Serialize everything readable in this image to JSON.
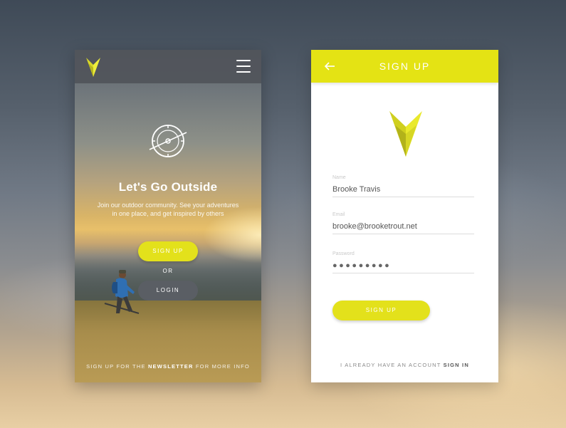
{
  "colors": {
    "accent": "#e3e11b",
    "login_button": "#5a5e64",
    "nav_overlay": "#50545a"
  },
  "left_screen": {
    "nav": {
      "logo_icon": "v-arrow-logo-icon",
      "menu_icon": "hamburger-menu-icon"
    },
    "hero": {
      "icon": "compass-icon",
      "title": "Let's Go Outside",
      "subtitle_line1": "Join our outdoor community. See your adventures",
      "subtitle_line2": "in one place, and get inspired by others"
    },
    "signup_button": "SIGN UP",
    "or_text": "OR",
    "login_button": "LOGIN",
    "footer": {
      "prefix": "SIGN UP FOR THE ",
      "link": "NEWSLETTER",
      "suffix": " FOR MORE INFO"
    }
  },
  "right_screen": {
    "header": {
      "back_icon": "back-arrow-icon",
      "title": "SIGN UP"
    },
    "logo_icon": "v-arrow-logo-icon",
    "fields": {
      "name": {
        "label": "Name",
        "value": "Brooke Travis"
      },
      "email": {
        "label": "Email",
        "value": "brooke@brooketrout.net"
      },
      "password": {
        "label": "Password",
        "value": "●●●●●●●●●"
      }
    },
    "signup_button": "SIGN UP",
    "footer": {
      "prefix": "I ALREADY HAVE AN ACCOUNT ",
      "link": "SIGN IN"
    }
  }
}
